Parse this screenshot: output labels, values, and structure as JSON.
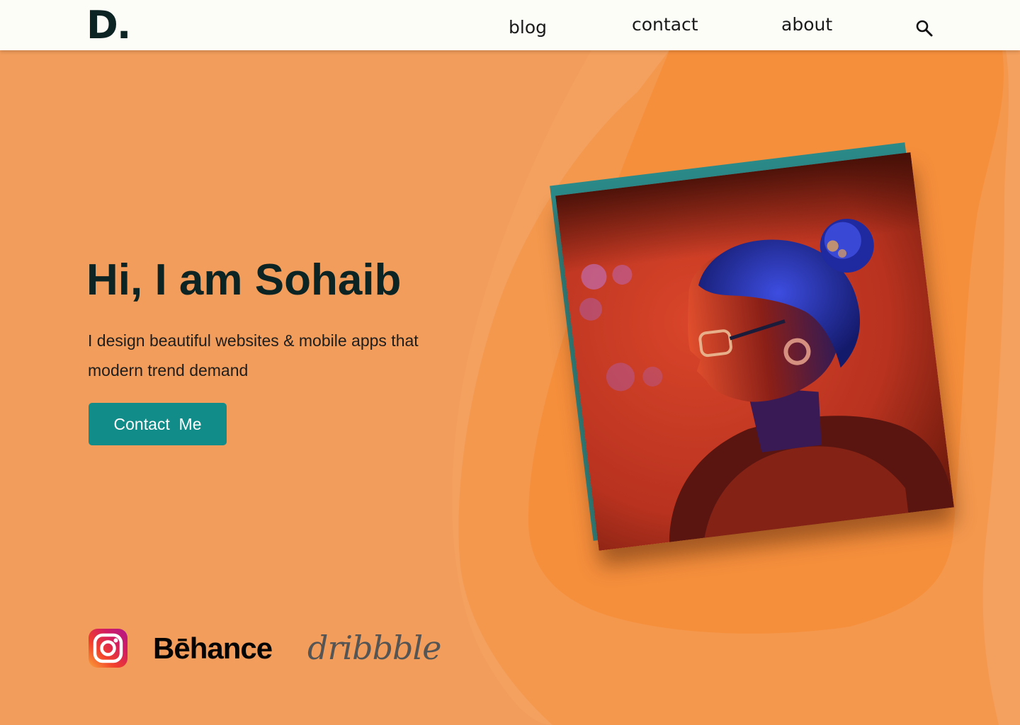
{
  "header": {
    "logo": "D.",
    "nav": [
      {
        "label": "blog"
      },
      {
        "label": "contact"
      },
      {
        "label": "about"
      }
    ],
    "search_icon": "search-icon"
  },
  "hero": {
    "title": "Hi, I am Sohaib",
    "subtitle": "I design beautiful websites & mobile apps that modern trend demand",
    "cta_label": "Contact  Me"
  },
  "photo": {
    "description_icon": "portrait-photo"
  },
  "social": {
    "instagram_icon": "instagram-icon",
    "behance_label": "Bēhance",
    "dribbble_label": "dribbble"
  },
  "colors": {
    "background": "#f29d5b",
    "blob": "#f48f3e",
    "header_bg": "#fdfdf8",
    "accent": "#128c88",
    "text_dark": "#0d2424"
  }
}
